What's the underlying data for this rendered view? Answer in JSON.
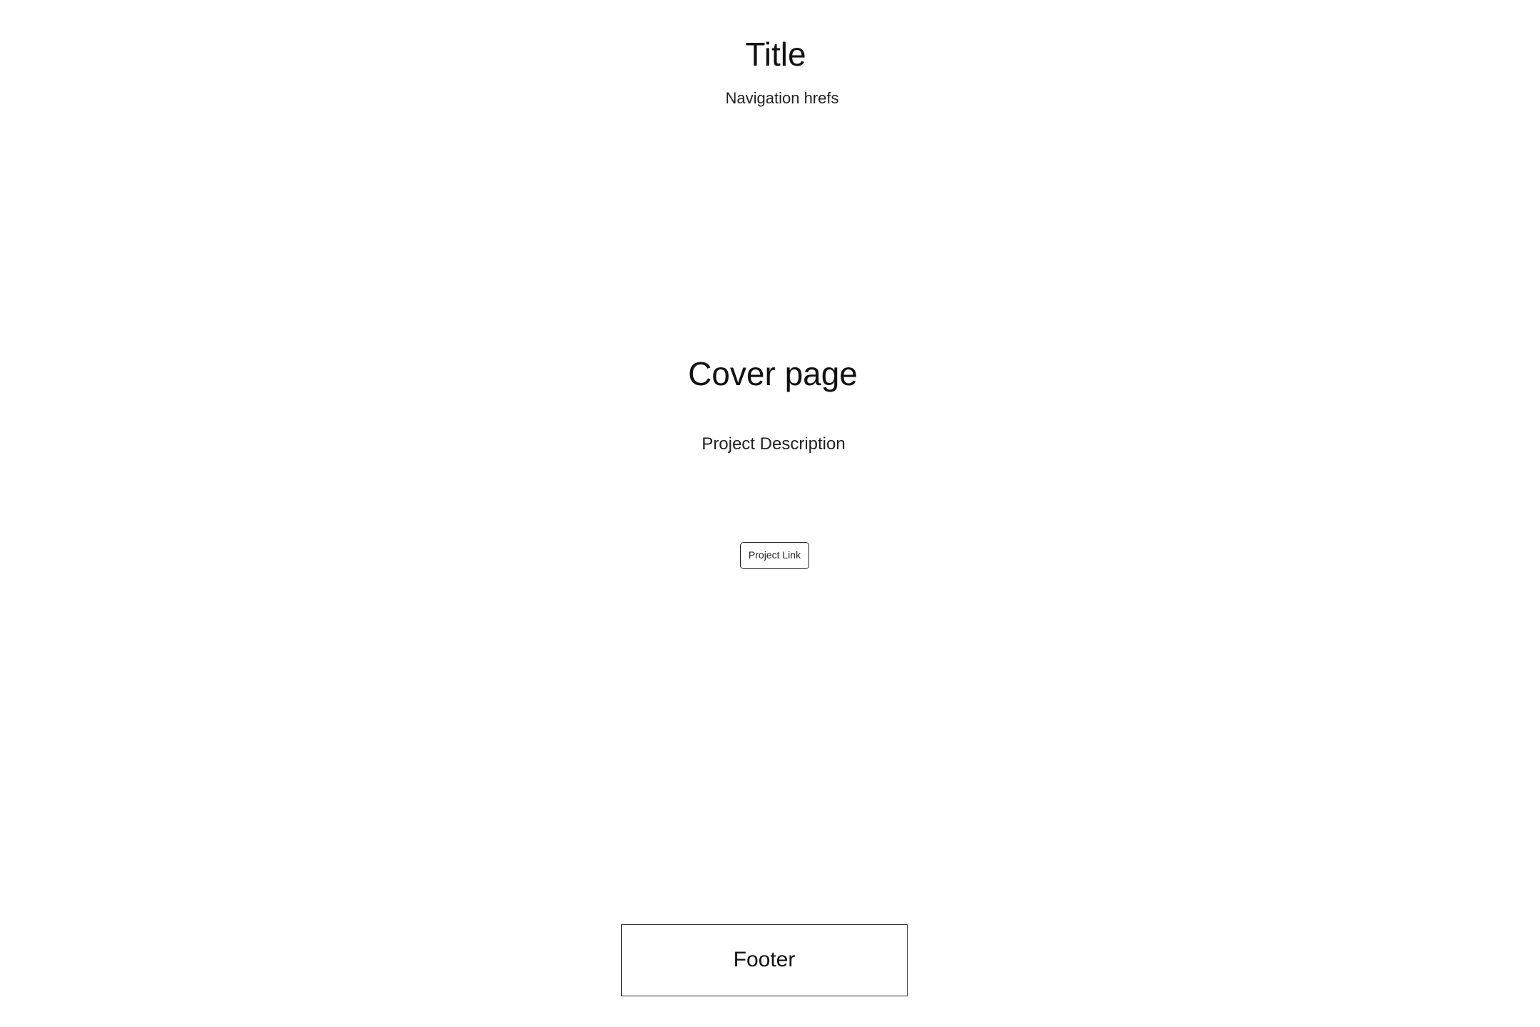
{
  "header": {
    "title": "Title",
    "nav_label": "Navigation hrefs"
  },
  "cover": {
    "heading": "Cover page",
    "description": "Project Description",
    "link_label": "Project Link"
  },
  "footer": {
    "label": "Footer"
  }
}
